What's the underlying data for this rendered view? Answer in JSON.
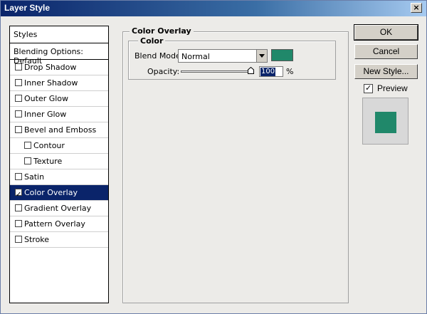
{
  "window": {
    "title": "Layer Style",
    "close_glyph": "×"
  },
  "styles_panel": {
    "header": "Styles",
    "blending_options": "Blending Options: Default",
    "items": [
      {
        "label": "Drop Shadow",
        "checked": false,
        "indent": false,
        "selected": false
      },
      {
        "label": "Inner Shadow",
        "checked": false,
        "indent": false,
        "selected": false
      },
      {
        "label": "Outer Glow",
        "checked": false,
        "indent": false,
        "selected": false
      },
      {
        "label": "Inner Glow",
        "checked": false,
        "indent": false,
        "selected": false
      },
      {
        "label": "Bevel and Emboss",
        "checked": false,
        "indent": false,
        "selected": false
      },
      {
        "label": "Contour",
        "checked": false,
        "indent": true,
        "selected": false
      },
      {
        "label": "Texture",
        "checked": false,
        "indent": true,
        "selected": false
      },
      {
        "label": "Satin",
        "checked": false,
        "indent": false,
        "selected": false
      },
      {
        "label": "Color Overlay",
        "checked": true,
        "indent": false,
        "selected": true
      },
      {
        "label": "Gradient Overlay",
        "checked": false,
        "indent": false,
        "selected": false
      },
      {
        "label": "Pattern Overlay",
        "checked": false,
        "indent": false,
        "selected": false
      },
      {
        "label": "Stroke",
        "checked": false,
        "indent": false,
        "selected": false
      }
    ]
  },
  "color_overlay": {
    "section_title": "Color Overlay",
    "group_title": "Color",
    "blend_mode_label": "Blend Mode:",
    "blend_mode_value": "Normal",
    "overlay_color": "#20886a",
    "opacity_label": "Opacity:",
    "opacity_value": "100",
    "opacity_unit": "%",
    "opacity_level": 1.0
  },
  "buttons": {
    "ok": "OK",
    "cancel": "Cancel",
    "new_style": "New Style..."
  },
  "preview": {
    "label": "Preview",
    "checked": true
  }
}
